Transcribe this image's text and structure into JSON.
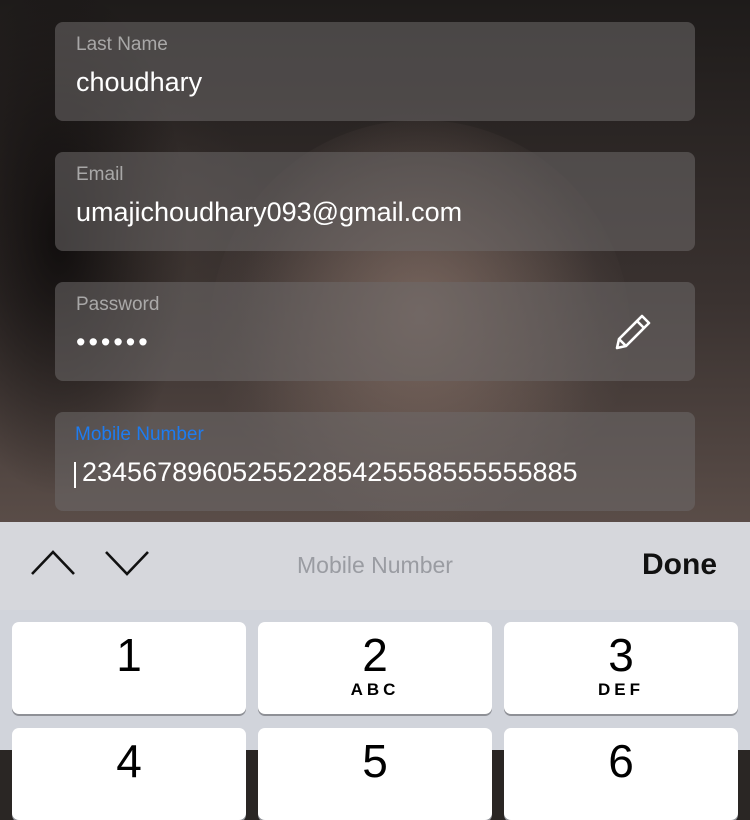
{
  "form": {
    "last_name": {
      "label": "Last Name",
      "value": "choudhary"
    },
    "email": {
      "label": "Email",
      "value": "umajichoudhary093@gmail.com"
    },
    "password": {
      "label": "Password",
      "value": "••••••",
      "icon": "pencil-edit-icon"
    },
    "mobile": {
      "label": "Mobile Number",
      "value": "234567896052552285425558555555885",
      "label_color": "#1E7CF0"
    }
  },
  "keyboard_bar": {
    "prev_icon": "chevron-up-icon",
    "next_icon": "chevron-down-icon",
    "title": "Mobile Number",
    "done_label": "Done"
  },
  "keypad": {
    "keys": [
      {
        "num": "1",
        "letters": ""
      },
      {
        "num": "2",
        "letters": "ABC"
      },
      {
        "num": "3",
        "letters": "DEF"
      },
      {
        "num": "4",
        "letters": ""
      },
      {
        "num": "5",
        "letters": ""
      },
      {
        "num": "6",
        "letters": ""
      }
    ]
  }
}
